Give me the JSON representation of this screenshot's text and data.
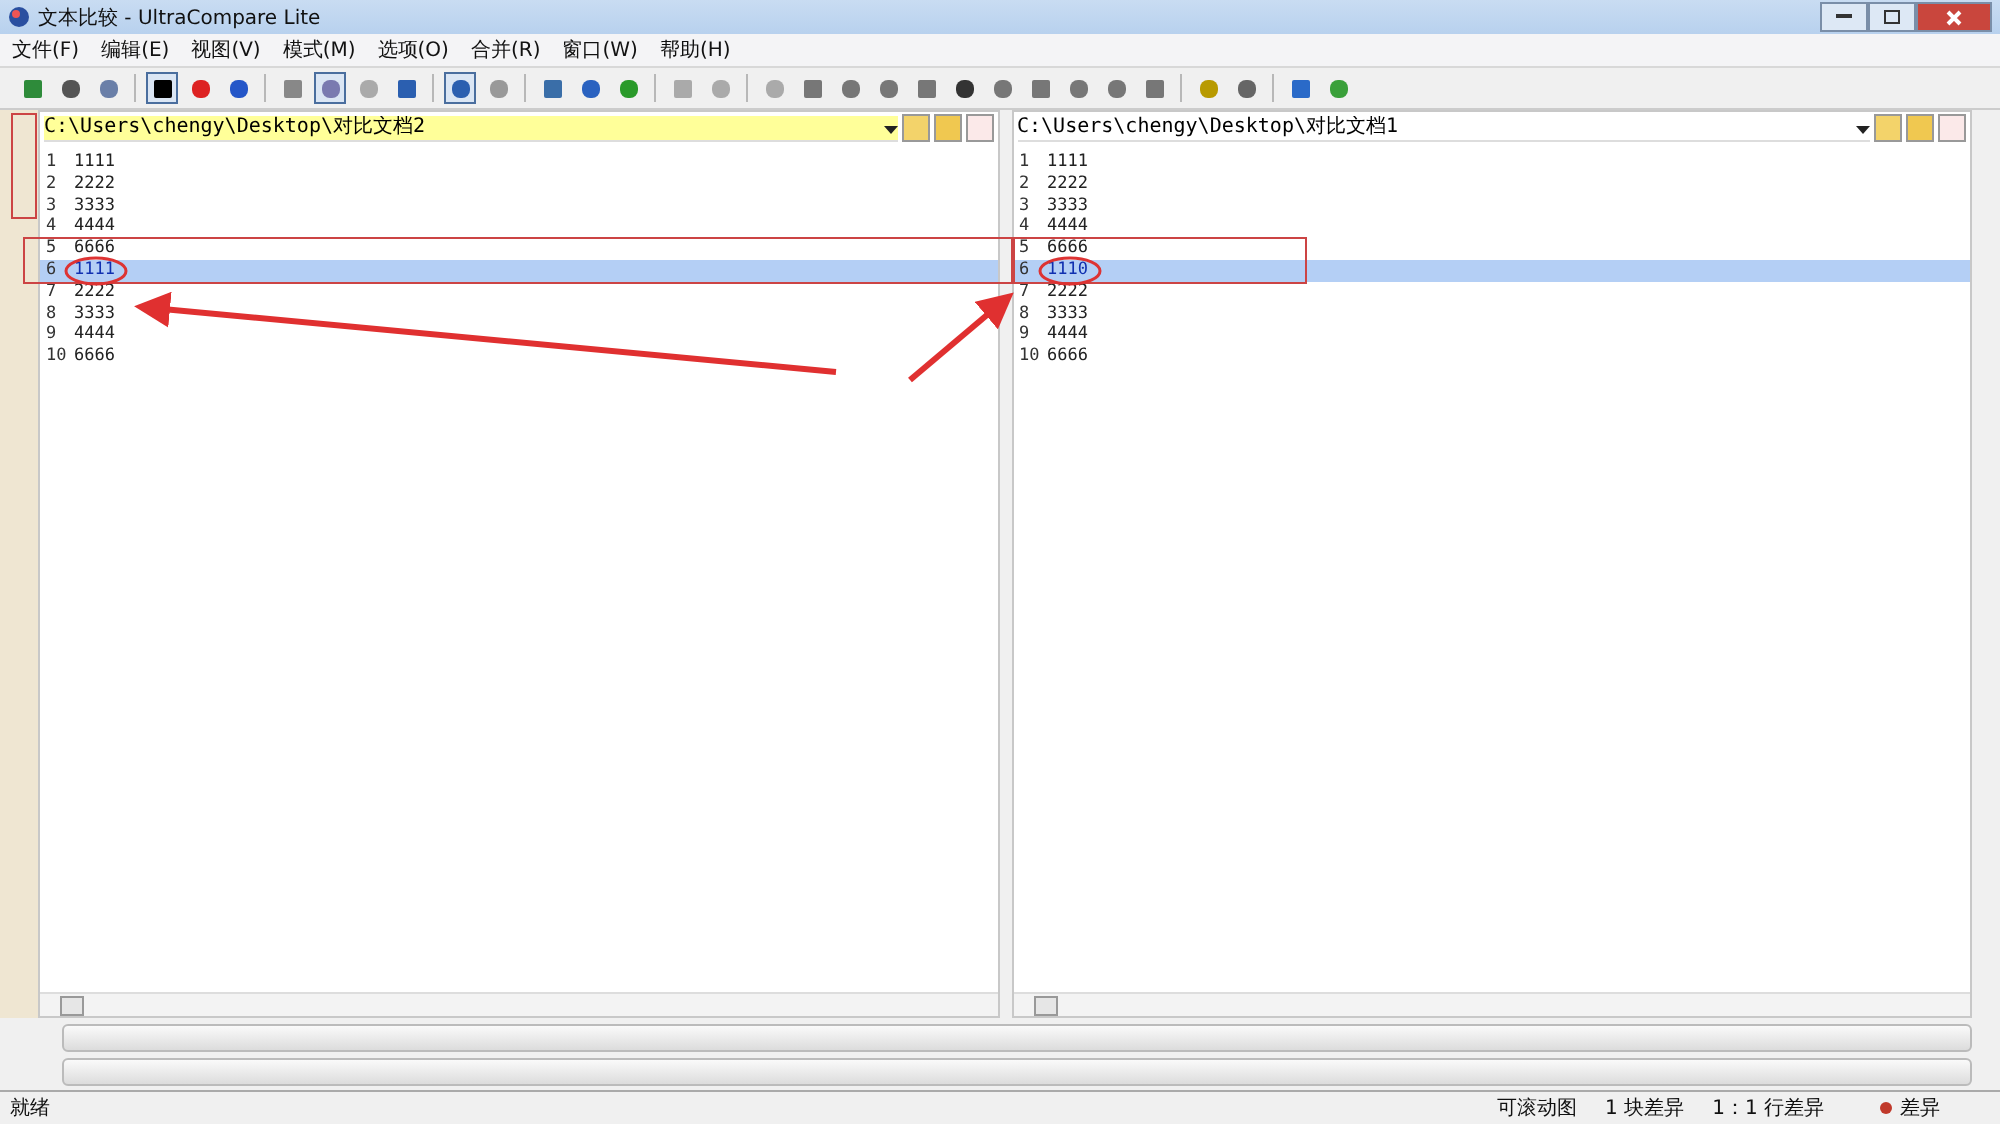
{
  "window": {
    "title": "文本比较 - UltraCompare Lite"
  },
  "menu": [
    "文件(F)",
    "编辑(E)",
    "视图(V)",
    "模式(M)",
    "选项(O)",
    "合并(R)",
    "窗口(W)",
    "帮助(H)"
  ],
  "panes": [
    {
      "path": "C:\\Users\\chengy\\Desktop\\对比文档2",
      "active": true,
      "lines": [
        {
          "number": "1",
          "text": "1111",
          "selected": false
        },
        {
          "number": "2",
          "text": "2222",
          "selected": false
        },
        {
          "number": "3",
          "text": "3333",
          "selected": false
        },
        {
          "number": "4",
          "text": "4444",
          "selected": false
        },
        {
          "number": "5",
          "text": "6666",
          "selected": false
        },
        {
          "number": "6",
          "text": "1111",
          "selected": true
        },
        {
          "number": "7",
          "text": "2222",
          "selected": false
        },
        {
          "number": "8",
          "text": "3333",
          "selected": false
        },
        {
          "number": "9",
          "text": "4444",
          "selected": false
        },
        {
          "number": "10",
          "text": "6666",
          "selected": false
        }
      ]
    },
    {
      "path": "C:\\Users\\chengy\\Desktop\\对比文档1",
      "active": false,
      "lines": [
        {
          "number": "1",
          "text": "1111",
          "selected": false
        },
        {
          "number": "2",
          "text": "2222",
          "selected": false
        },
        {
          "number": "3",
          "text": "3333",
          "selected": false
        },
        {
          "number": "4",
          "text": "4444",
          "selected": false
        },
        {
          "number": "5",
          "text": "6666",
          "selected": false
        },
        {
          "number": "6",
          "text": "1110",
          "selected": true
        },
        {
          "number": "7",
          "text": "2222",
          "selected": false
        },
        {
          "number": "8",
          "text": "3333",
          "selected": false
        },
        {
          "number": "9",
          "text": "4444",
          "selected": false
        },
        {
          "number": "10",
          "text": "6666",
          "selected": false
        }
      ]
    }
  ],
  "status_bar": {
    "state": "就绪",
    "scroll": "可滚动图",
    "blocks": "1 块差异",
    "lines": "1：1 行差异",
    "legend": {
      "label": "差异",
      "color": "#c0392b"
    }
  }
}
